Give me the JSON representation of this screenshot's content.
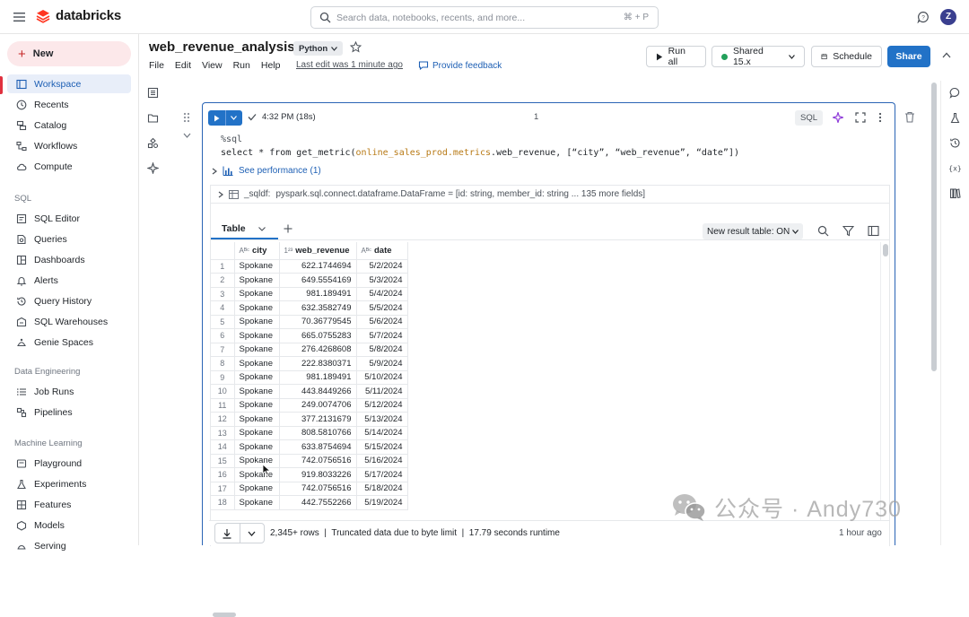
{
  "topbar": {
    "brand": "databricks",
    "search_placeholder": "Search data, notebooks, recents, and more...",
    "search_shortcut": "⌘ + P",
    "user_initial": "Z"
  },
  "sidebar": {
    "new_label": "New",
    "items_top": [
      {
        "label": "Workspace",
        "icon": "folder-icon",
        "active": true
      },
      {
        "label": "Recents",
        "icon": "clock-icon"
      },
      {
        "label": "Catalog",
        "icon": "catalog-icon"
      },
      {
        "label": "Workflows",
        "icon": "workflow-icon"
      },
      {
        "label": "Compute",
        "icon": "cloud-icon"
      }
    ],
    "section_sql": "SQL",
    "items_sql": [
      {
        "label": "SQL Editor",
        "icon": "editor-icon"
      },
      {
        "label": "Queries",
        "icon": "query-icon"
      },
      {
        "label": "Dashboards",
        "icon": "dashboard-icon"
      },
      {
        "label": "Alerts",
        "icon": "bell-icon"
      },
      {
        "label": "Query History",
        "icon": "history-icon"
      },
      {
        "label": "SQL Warehouses",
        "icon": "warehouse-icon"
      },
      {
        "label": "Genie Spaces",
        "icon": "genie-icon"
      }
    ],
    "section_de": "Data Engineering",
    "items_de": [
      {
        "label": "Job Runs",
        "icon": "list-icon"
      },
      {
        "label": "Pipelines",
        "icon": "pipeline-icon"
      }
    ],
    "section_ml": "Machine Learning",
    "items_ml": [
      {
        "label": "Playground",
        "icon": "playground-icon"
      },
      {
        "label": "Experiments",
        "icon": "flask-icon"
      },
      {
        "label": "Features",
        "icon": "features-icon"
      },
      {
        "label": "Models",
        "icon": "models-icon"
      },
      {
        "label": "Serving",
        "icon": "serving-icon"
      }
    ]
  },
  "notebook": {
    "title": "web_revenue_analysis",
    "language": "Python",
    "menu": [
      "File",
      "Edit",
      "View",
      "Run",
      "Help"
    ],
    "last_edit": "Last edit was 1 minute ago",
    "feedback": "Provide feedback",
    "run_all": "Run all",
    "cluster": "Shared 15.x",
    "schedule": "Schedule",
    "share": "Share"
  },
  "cell": {
    "exec_time": "4:32 PM (18s)",
    "cell_number": "1",
    "lang_badge": "SQL",
    "code_line1": "%sql",
    "code_kw1": "select",
    "code_star": " * ",
    "code_kw2": "from",
    "code_fn": " get_metric(",
    "code_mod": "online_sales_prod.metrics",
    "code_rest": ".web_revenue, [“city”, “web_revenue”, “date”])",
    "see_performance": "See performance (1)",
    "df_name": "_sqldf:",
    "df_type": "pyspark.sql.connect.dataframe.DataFrame = [id: string, member_id: string ... 135 more fields]"
  },
  "results": {
    "tab_label": "Table",
    "new_result_table": "New result table: ON",
    "columns": [
      {
        "label": "city",
        "type_icon": "Aᴮᶜ"
      },
      {
        "label": "web_revenue",
        "type_icon": "1²³"
      },
      {
        "label": "date",
        "type_icon": "Aᴮᶜ"
      }
    ],
    "rows": [
      [
        "1",
        "Spokane",
        "622.1744694",
        "5/2/2024"
      ],
      [
        "2",
        "Spokane",
        "649.5554169",
        "5/3/2024"
      ],
      [
        "3",
        "Spokane",
        "981.189491",
        "5/4/2024"
      ],
      [
        "4",
        "Spokane",
        "632.3582749",
        "5/5/2024"
      ],
      [
        "5",
        "Spokane",
        "70.36779545",
        "5/6/2024"
      ],
      [
        "6",
        "Spokane",
        "665.0755283",
        "5/7/2024"
      ],
      [
        "7",
        "Spokane",
        "276.4268608",
        "5/8/2024"
      ],
      [
        "8",
        "Spokane",
        "222.8380371",
        "5/9/2024"
      ],
      [
        "9",
        "Spokane",
        "981.189491",
        "5/10/2024"
      ],
      [
        "10",
        "Spokane",
        "443.8449266",
        "5/11/2024"
      ],
      [
        "11",
        "Spokane",
        "249.0074706",
        "5/12/2024"
      ],
      [
        "12",
        "Spokane",
        "377.2131679",
        "5/13/2024"
      ],
      [
        "13",
        "Spokane",
        "808.5810766",
        "5/14/2024"
      ],
      [
        "14",
        "Spokane",
        "633.8754694",
        "5/15/2024"
      ],
      [
        "15",
        "Spokane",
        "742.0756516",
        "5/16/2024"
      ],
      [
        "16",
        "Spokane",
        "919.8033226",
        "5/17/2024"
      ],
      [
        "17",
        "Spokane",
        "742.0756516",
        "5/18/2024"
      ],
      [
        "18",
        "Spokane",
        "442.7552266",
        "5/19/2024"
      ]
    ],
    "footer_rows": "2,345+ rows",
    "footer_sep": "|",
    "footer_truncated": "Truncated data due to byte limit",
    "footer_runtime": "17.79 seconds runtime",
    "footer_time": "1 hour ago"
  },
  "watermark": {
    "text": "公众号 · Andy730"
  }
}
